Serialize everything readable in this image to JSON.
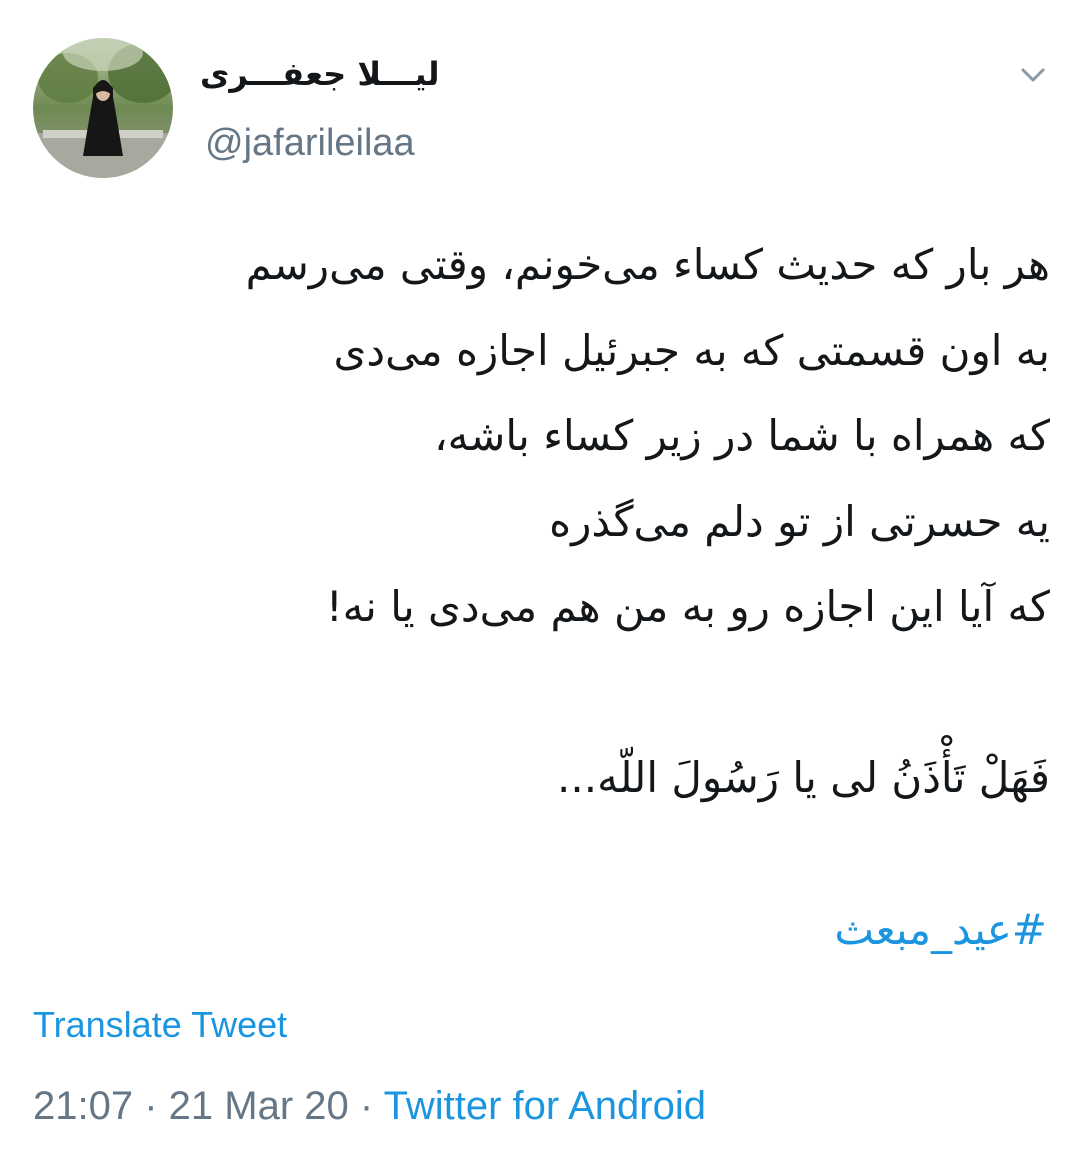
{
  "author": {
    "display_name": "لیـــلا جعفـــری",
    "handle": "@jafarileilaa",
    "avatar_icon": "profile-photo"
  },
  "menu": {
    "icon": "chevron-down-icon"
  },
  "tweet": {
    "lines": [
      "هر بار که حدیث کساء می‌خونم، وقتی می‌رسم",
      "به اون قسمتی که به جبرئیل اجازه می‌دی",
      "که همراه با شما در زیر کساء باشه،",
      "یه حسرتی از تو دلم می‌گذره",
      "که آیا این اجازه رو به من هم می‌دی یا نه!",
      "",
      "فَهَلْ تَأْذَنُ لی یا رَسُولَ اللّه..."
    ],
    "hashtag": "#عید_مبعث"
  },
  "translate_label": "Translate Tweet",
  "meta": {
    "time": "21:07",
    "separator": " · ",
    "date": "21 Mar 20",
    "source": "Twitter for Android"
  },
  "colors": {
    "text": "#14171a",
    "secondary": "#657786",
    "link": "#1b95e0"
  }
}
